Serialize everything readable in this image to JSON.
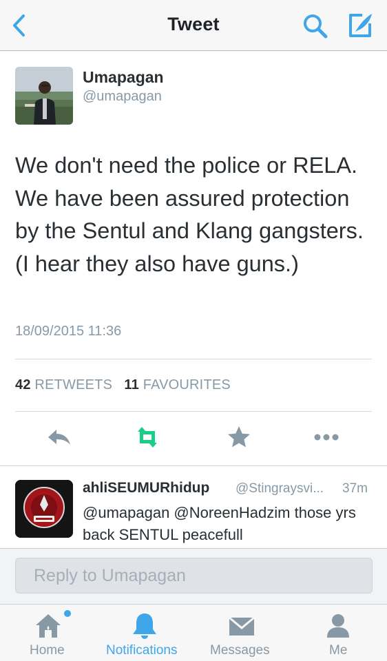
{
  "nav": {
    "title": "Tweet"
  },
  "tweet": {
    "display_name": "Umapagan",
    "screen_name": "@umapagan",
    "text": "We don't need the police or RELA. We have been assured protection by the Sentul and Klang gangsters. (I hear they also have guns.)",
    "timestamp": "18/09/2015 11:36",
    "retweets_count": "42",
    "retweets_label": "RETWEETS",
    "favourites_count": "11",
    "favourites_label": "FAVOURITES"
  },
  "reply": {
    "name": "ahliSEUMURhidup",
    "handle": "@Stingraysvi...",
    "time": "37m",
    "text": "@umapagan @NoreenHadzim those yrs back SENTUL peacefull"
  },
  "reply_box": {
    "placeholder": "Reply to Umapagan"
  },
  "tabs": [
    {
      "label": "Home",
      "icon": "home-icon"
    },
    {
      "label": "Notifications",
      "icon": "bell-icon"
    },
    {
      "label": "Messages",
      "icon": "envelope-icon"
    },
    {
      "label": "Me",
      "icon": "person-icon"
    }
  ],
  "colors": {
    "accent": "#3fa6ea",
    "retweet": "#19cf86",
    "muted": "#8899a6",
    "text": "#292f33"
  }
}
